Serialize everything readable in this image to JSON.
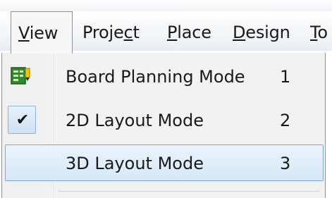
{
  "menubar": {
    "items": [
      {
        "pre": "",
        "key": "V",
        "post": "iew"
      },
      {
        "pre": "Proje",
        "key": "c",
        "post": "t"
      },
      {
        "pre": "",
        "key": "P",
        "post": "lace"
      },
      {
        "pre": "",
        "key": "D",
        "post": "esign"
      },
      {
        "pre": "",
        "key": "T",
        "post": "o"
      }
    ]
  },
  "view_menu": {
    "items": [
      {
        "label": "Board Planning Mode",
        "shortcut": "1",
        "icon": "board-planning-icon"
      },
      {
        "label": "2D Layout Mode",
        "shortcut": "2",
        "icon": "checkmark-icon",
        "checked": true
      },
      {
        "label": "3D Layout Mode",
        "shortcut": "3",
        "highlighted": true
      }
    ]
  },
  "colors": {
    "highlight_border": "#7ea8d6",
    "highlight_fill": "#d7e8f9",
    "board_icon_green": "#2f8a2c"
  }
}
